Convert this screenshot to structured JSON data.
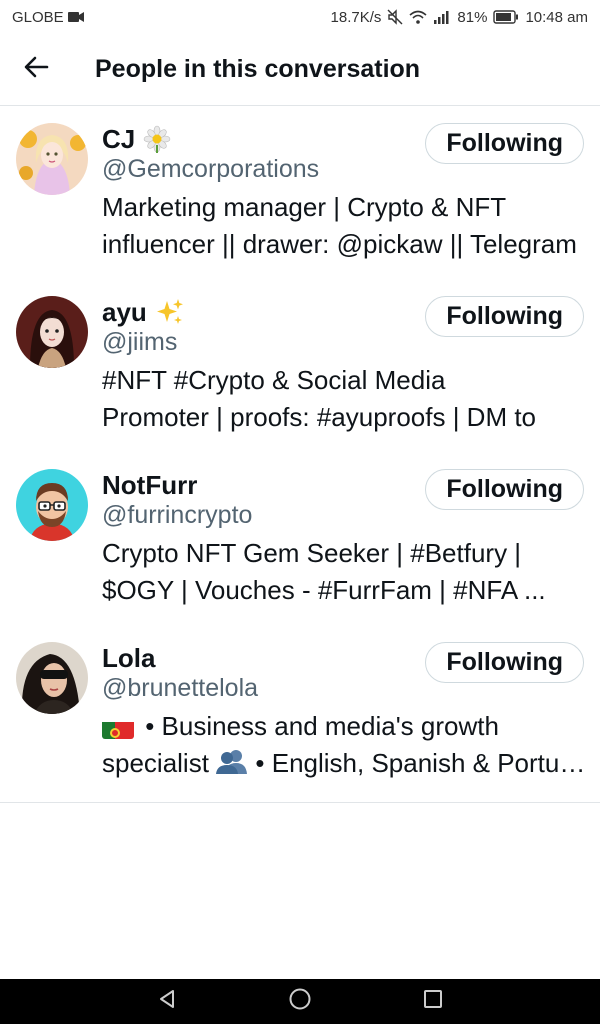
{
  "status_bar": {
    "carrier": "GLOBE",
    "net_speed": "18.7K/s",
    "battery": "81%",
    "time": "10:48 am"
  },
  "header": {
    "title": "People in this conversation"
  },
  "users": [
    {
      "name": "CJ",
      "emoji": "flower-emoji",
      "handle": "@Gemcorporations",
      "bio_line1": "Marketing manager | Crypto & NFT",
      "bio_line2": "influencer || drawer: @pickaw || Telegram",
      "button": "Following"
    },
    {
      "name": "ayu",
      "emoji": "sparkles-emoji",
      "handle": "@jiims",
      "bio_line1": "#NFT #Crypto & Social Media",
      "bio_line2": "Promoter | proofs: #ayuproofs | DM to",
      "button": "Following"
    },
    {
      "name": "NotFurr",
      "handle": "@furrincrypto",
      "bio_line1": "Crypto NFT Gem Seeker | #Betfury  |",
      "bio_line2": "$OGY | Vouches - #FurrFam | #NFA ...",
      "button": "Following"
    },
    {
      "name": "Lola",
      "handle": "@brunettelola",
      "bio_line1": "• Business and media's growth",
      "bio_line2": "specialist",
      "bio_line2b": "• English, Spanish & Portuguese",
      "button": "Following"
    }
  ],
  "colors": {
    "text": "#0f1419",
    "secondary": "#536471",
    "border": "#cfd9de"
  }
}
